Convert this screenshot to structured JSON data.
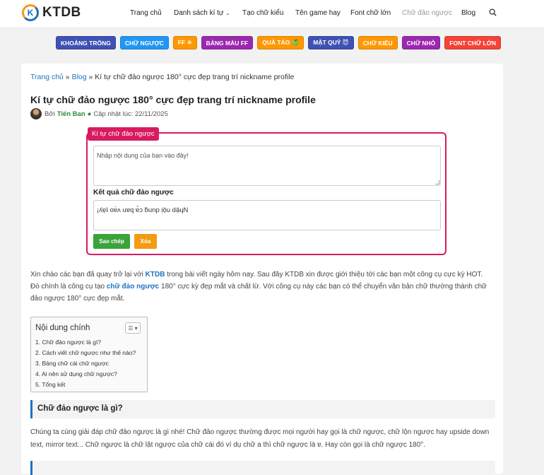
{
  "header": {
    "logo_letter": "K",
    "logo_text": "KTDB",
    "nav": [
      {
        "label": "Trang chủ"
      },
      {
        "label": "Danh sách kí tự"
      },
      {
        "label": "Tạo chữ kiểu"
      },
      {
        "label": "Tên game hay"
      },
      {
        "label": "Font chữ lớn"
      },
      {
        "label": "Chữ đảo ngược"
      },
      {
        "label": "Blog"
      }
    ]
  },
  "tags": [
    {
      "label": "KHOẢNG TRỐNG",
      "color": "#3f51b5"
    },
    {
      "label": "CHỮ NGƯỢC",
      "color": "#2196f3"
    },
    {
      "label": "FF ❄",
      "color": "#ff9800"
    },
    {
      "label": "BẢNG MÀU FF",
      "color": "#9c27b0"
    },
    {
      "label": "QUẢ TÁO 🍏",
      "color": "#ff9800"
    },
    {
      "label": "MẶT QUỶ 😈",
      "color": "#3f51b5"
    },
    {
      "label": "CHỮ KIỂU",
      "color": "#ff9800"
    },
    {
      "label": "CHỮ NHỎ",
      "color": "#9c27b0"
    },
    {
      "label": "FONT CHỮ LỚN",
      "color": "#f44336"
    }
  ],
  "breadcrumb": {
    "home": "Trang chủ",
    "sep1": " » ",
    "blog": "Blog",
    "sep2": " » ",
    "current": "Kí tự chữ đảo ngược 180° cực đẹp trang trí nickname profile"
  },
  "article": {
    "title": "Kí tự chữ đảo ngược 180° cực đẹp trang trí nickname profile",
    "by": "Bởi",
    "author": "Tiến Ban",
    "dot": "●",
    "updated": "Cập nhật lúc: 22/11/2025"
  },
  "tool": {
    "badge": "Kí tự chữ đảo ngược",
    "input_placeholder": "Nhập nội dung của bạn vào đây!",
    "result_label": "Kết quả chữ đảo ngược",
    "output_value": "¡ʎɐ̣ʇ oɐ̀ʌ uɐq ɐ̉ɔ ƃunp ịộu dậɥN",
    "copy_button": "Sao chép",
    "clear_button": "Xóa"
  },
  "intro": {
    "p1": "Xin chào các bạn đã quay trở lại với ",
    "brand": "KTDB",
    "p2": " trong bài viết ngày hôm nay. Sau đây KTDB xin được giới thiệu tới các bạn một công cụ cực kỳ HOT. Đó chính là công cụ tạo ",
    "link": "chữ đảo ngược",
    "p3": " 180° cực kỳ đẹp mắt và chất lừ. Với công cụ này các bạn có thể chuyển văn bản chữ thường thành chữ đảo ngược 180° cực đẹp mắt."
  },
  "toc": {
    "title": "Nội dung chính",
    "items": [
      "1. Chữ đảo ngược là gì?",
      "2. Cách viết chữ ngược như thế nào?",
      "3. Bảng chữ cái chữ ngược",
      "4. Ai nên sử dụng chữ ngược?",
      "5. Tổng kết"
    ]
  },
  "section1": {
    "title": "Chữ đảo ngược là gì?",
    "text": "Chúng ta cùng giải đáp chữ đảo ngược là gì nhé! Chữ đảo ngược thường được mọi người hay gọi là chữ ngược, chữ lộn ngược hay upside down text, mirror text... Chữ ngược là chữ lật ngược của chữ cái đó ví dụ chữ a thì chữ ngược là ɐ. Hay còn gọi là chữ ngược 180°."
  }
}
